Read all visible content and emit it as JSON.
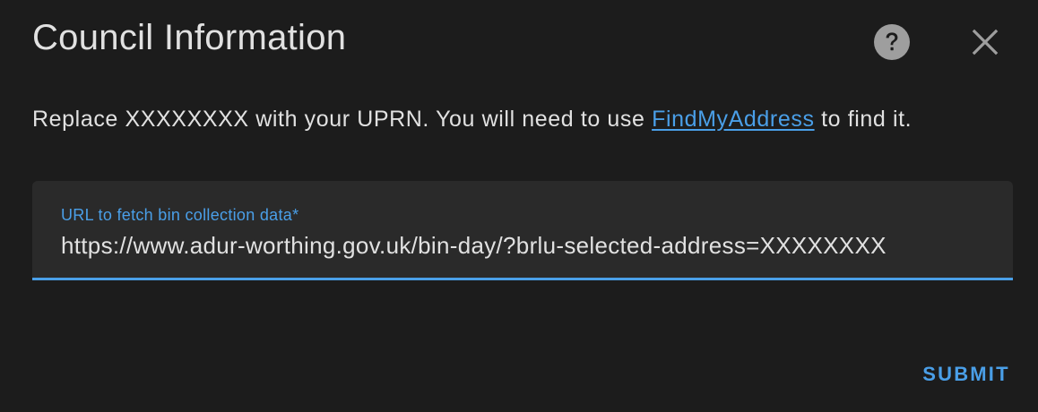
{
  "dialog": {
    "title": "Council Information",
    "help_icon": "help-circle-icon",
    "close_icon": "close-icon"
  },
  "description": {
    "before": "Replace XXXXXXXX with your UPRN. You will need to use ",
    "link_text": "FindMyAddress",
    "after": " to find it."
  },
  "url_field": {
    "label": "URL to fetch bin collection data*",
    "value": "https://www.adur-worthing.gov.uk/bin-day/?brlu-selected-address=XXXXXXXX"
  },
  "actions": {
    "submit_label": "SUBMIT"
  },
  "colors": {
    "background": "#1c1c1c",
    "field_background": "#2a2a2a",
    "text": "#e1e1e1",
    "accent": "#4a9fe8",
    "icon": "#9e9e9e"
  }
}
